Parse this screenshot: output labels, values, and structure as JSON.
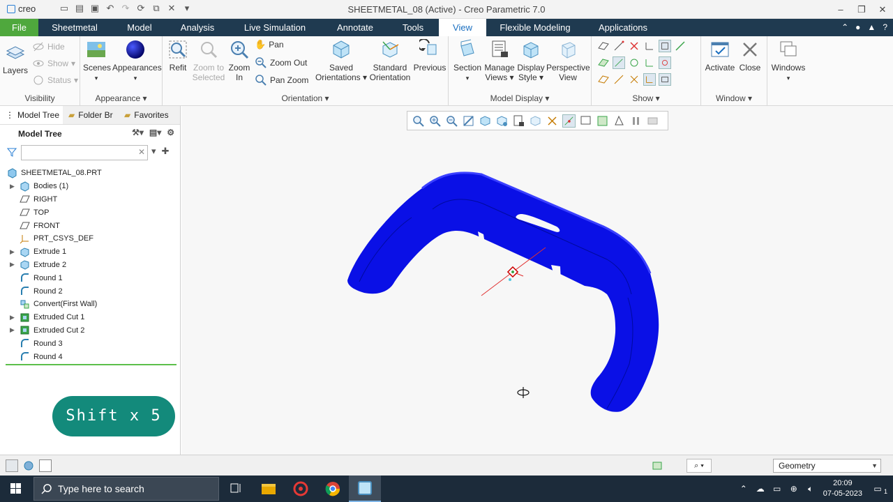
{
  "window": {
    "app_logo": "creo",
    "title": "SHEETMETAL_08 (Active) - Creo Parametric 7.0",
    "controls": [
      "–",
      "❐",
      "✕"
    ]
  },
  "menu_tabs": [
    {
      "label": "File"
    },
    {
      "label": "Sheetmetal"
    },
    {
      "label": "Model"
    },
    {
      "label": "Analysis"
    },
    {
      "label": "Live Simulation"
    },
    {
      "label": "Annotate"
    },
    {
      "label": "Tools"
    },
    {
      "label": "View"
    },
    {
      "label": "Flexible Modeling"
    },
    {
      "label": "Applications"
    }
  ],
  "active_tab": "View",
  "ribbon": {
    "visibility": {
      "layers": "Layers",
      "hide": "Hide",
      "show": "Show",
      "status": "Status",
      "label": "Visibility"
    },
    "appearance": {
      "scenes": "Scenes",
      "appearances": "Appearances",
      "label": "Appearance ▾"
    },
    "orientation": {
      "refit": "Refit",
      "zoom_to_selected_1": "Zoom to",
      "zoom_to_selected_2": "Selected",
      "zoom_in_1": "Zoom",
      "zoom_in_2": "In",
      "pan": "Pan",
      "zoom_out": "Zoom Out",
      "pan_zoom": "Pan Zoom",
      "saved_1": "Saved",
      "saved_2": "Orientations ▾",
      "standard_1": "Standard",
      "standard_2": "Orientation",
      "previous": "Previous",
      "label": "Orientation ▾"
    },
    "model_display": {
      "section": "Section",
      "manage_1": "Manage",
      "manage_2": "Views ▾",
      "display_1": "Display",
      "display_2": "Style ▾",
      "perspective_1": "Perspective",
      "perspective_2": "View",
      "label": "Model Display ▾"
    },
    "show": {
      "label": "Show ▾"
    },
    "window": {
      "activate": "Activate",
      "close": "Close",
      "windows": "Windows",
      "label": "Window ▾"
    }
  },
  "left_panel": {
    "tabs": [
      "Model Tree",
      "Folder Br",
      "Favorites"
    ],
    "tree_title": "Model Tree",
    "filter_placeholder": "",
    "items": [
      {
        "label": "SHEETMETAL_08.PRT",
        "expandable": false,
        "icon": "part-icon"
      },
      {
        "label": "Bodies (1)",
        "expandable": true,
        "icon": "bodies-icon"
      },
      {
        "label": "RIGHT",
        "expandable": false,
        "icon": "datum-plane-icon"
      },
      {
        "label": "TOP",
        "expandable": false,
        "icon": "datum-plane-icon"
      },
      {
        "label": "FRONT",
        "expandable": false,
        "icon": "datum-plane-icon"
      },
      {
        "label": "PRT_CSYS_DEF",
        "expandable": false,
        "icon": "csys-icon"
      },
      {
        "label": "Extrude 1",
        "expandable": true,
        "icon": "extrude-icon"
      },
      {
        "label": "Extrude 2",
        "expandable": true,
        "icon": "extrude-icon"
      },
      {
        "label": "Round 1",
        "expandable": false,
        "icon": "round-icon"
      },
      {
        "label": "Round 2",
        "expandable": false,
        "icon": "round-icon"
      },
      {
        "label": "Convert(First Wall)",
        "expandable": false,
        "icon": "convert-icon"
      },
      {
        "label": "Extruded Cut 1",
        "expandable": true,
        "icon": "extruded-cut-icon"
      },
      {
        "label": "Extruded Cut 2",
        "expandable": true,
        "icon": "extruded-cut-icon"
      },
      {
        "label": "Round 3",
        "expandable": false,
        "icon": "round-icon"
      },
      {
        "label": "Round 4",
        "expandable": false,
        "icon": "round-icon"
      }
    ]
  },
  "overlay": {
    "shift_badge": "Shift x 5"
  },
  "status_bar": {
    "selection_filter": "Geometry"
  },
  "taskbar": {
    "search_placeholder": "Type here to search",
    "time": "20:09",
    "date": "07-05-2023",
    "notification_count": "1"
  },
  "colors": {
    "model_blue": "#0a10e6",
    "tab_bar": "#1f3a50",
    "file_tab": "#4fa83d",
    "active_tab_text": "#1a6fc0",
    "badge": "#138a7b"
  }
}
